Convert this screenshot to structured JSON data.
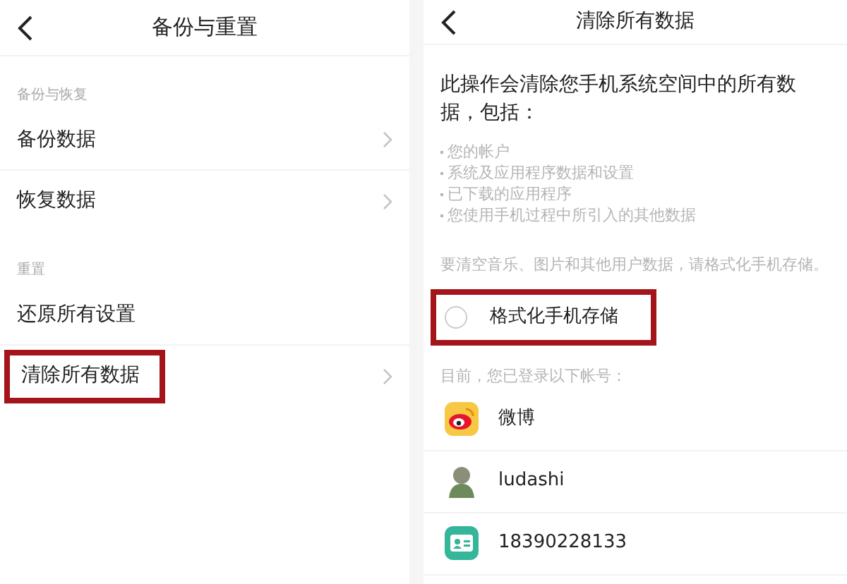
{
  "left_screen": {
    "title": "备份与重置",
    "sections": [
      {
        "header": "备份与恢复",
        "items": [
          {
            "label": "备份数据",
            "has_arrow": true,
            "highlighted": false
          },
          {
            "label": "恢复数据",
            "has_arrow": true,
            "highlighted": false
          }
        ]
      },
      {
        "header": "重置",
        "items": [
          {
            "label": "还原所有设置",
            "has_arrow": false,
            "highlighted": false
          },
          {
            "label": "清除所有数据",
            "has_arrow": true,
            "highlighted": true
          }
        ]
      }
    ]
  },
  "right_screen": {
    "title": "清除所有数据",
    "description": "此操作会清除您手机系统空间中的所有数据，包括：",
    "bullets": [
      "您的帐户",
      "系统及应用程序数据和设置",
      "已下载的应用程序",
      "您使用手机过程中所引入的其他数据"
    ],
    "note": "要清空音乐、图片和其他用户数据，请格式化手机存储。",
    "format_option": {
      "label": "格式化手机存储",
      "checked": false,
      "highlighted": true
    },
    "accounts_header": "目前，您已登录以下帐号：",
    "accounts": [
      {
        "kind": "weibo",
        "name": "微博"
      },
      {
        "kind": "figure",
        "name": "ludashi"
      },
      {
        "kind": "contact",
        "name": "18390228133"
      }
    ]
  }
}
